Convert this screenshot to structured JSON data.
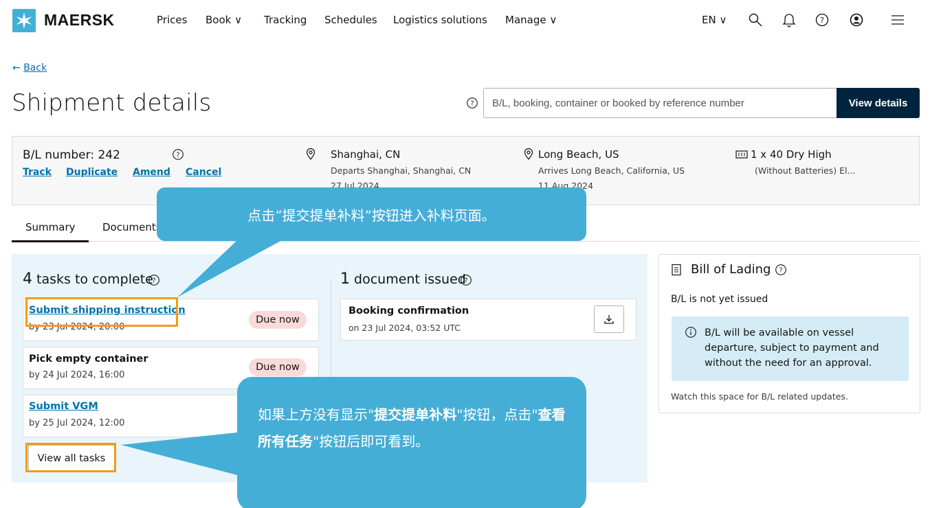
{
  "header": {
    "brand": "MAERSK",
    "nav": [
      "Prices",
      "Book ∨",
      "Tracking",
      "Schedules",
      "Logistics solutions",
      "Manage ∨"
    ],
    "language": "EN ∨"
  },
  "back_label": "Back",
  "page_title": "Shipment details",
  "search": {
    "placeholder": "B/L, booking, container or booked by reference number",
    "button_label": "View details"
  },
  "shipment": {
    "bl_label": "B/L number: 242",
    "actions": [
      "Track",
      "Duplicate",
      "Amend",
      "Cancel"
    ],
    "origin": {
      "title": "Shanghai, CN",
      "sub": "Departs Shanghai, Shanghai, CN",
      "date": "27 Jul 2024"
    },
    "destination": {
      "title": "Long Beach, US",
      "sub": "Arrives Long Beach, California, US",
      "date": "11 Aug 2024"
    },
    "container": {
      "title": "1 x 40 Dry High",
      "sub": "(Without Batteries) El..."
    }
  },
  "tabs": [
    "Summary",
    "Documents"
  ],
  "tasks": {
    "count": "4",
    "heading": "tasks to complete",
    "items": [
      {
        "title": "Submit shipping instruction",
        "due": "by 23 Jul 2024, 20:00",
        "badge": "Due now"
      },
      {
        "title": "Pick empty container",
        "due": "by 24 Jul 2024, 16:00",
        "badge": "Due now"
      },
      {
        "title": "Submit VGM",
        "due": "by 25 Jul 2024, 12:00",
        "badge": ""
      }
    ],
    "view_all_label": "View all tasks"
  },
  "documents": {
    "count": "1",
    "heading": "document issued",
    "items": [
      {
        "title": "Booking confirmation",
        "date": "on 23 Jul 2024, 03:52 UTC"
      }
    ]
  },
  "bill_of_lading": {
    "title": "Bill of Lading",
    "status": "B/L is not yet issued",
    "info": "B/L will be available on vessel departure, subject to payment and without the need for an approval.",
    "footer": "Watch this space for B/L related updates."
  },
  "callouts": {
    "top": "点击“提交提单补料”按钮进入补料页面。",
    "bottom_part1": "如果上方没有显示\"",
    "bottom_bold1": "提交提单补料",
    "bottom_part2": "\"按钮，点击\"",
    "bottom_bold2": "查看所有任务",
    "bottom_part3": "\"按钮后即可看到。"
  },
  "colors": {
    "brand": "#42b0d5",
    "dark_button": "#00243d",
    "link": "#0073ab",
    "callout": "#45aed6",
    "highlight": "#f39c12",
    "badge": "#fad9d9"
  }
}
